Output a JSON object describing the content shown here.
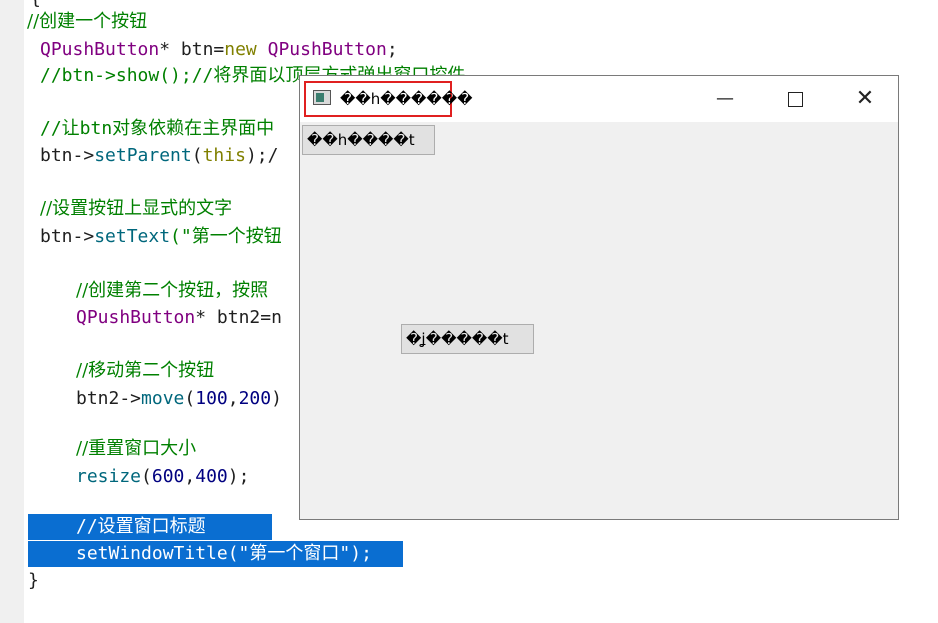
{
  "editor": {
    "top_brace": "{",
    "close_brace": "}",
    "lines": {
      "l1": "//创建一个按钮",
      "l2_type": "QPushButton",
      "l2_mid": "* btn=",
      "l2_new": "new",
      "l2_sp": " ",
      "l2_type2": "QPushButton",
      "l2_end": ";",
      "l3": "//btn->show();//将界面以顶层方式弹出窗口控件",
      "l5": "//让btn对象依赖在主界面中",
      "l6_a": "btn->",
      "l6_fn": "setParent",
      "l6_b": "(",
      "l6_kw": "this",
      "l6_c": ");/",
      "l8": "//设置按钮上显式的文字",
      "l9_a": "btn->",
      "l9_fn": "setText",
      "l9_b": "(\"第一个按钮",
      "l11": "//创建第二个按钮，按照",
      "l12_type": "QPushButton",
      "l12_mid": "* btn2=n",
      "l14": "//移动第二个按钮",
      "l15_a": "btn2->",
      "l15_fn": "move",
      "l15_b": "(",
      "l15_n1": "100",
      "l15_c": ",",
      "l15_n2": "200",
      "l15_d": ")",
      "l17": "//重置窗口大小",
      "l18_fn": "resize",
      "l18_b": "(",
      "l18_n1": "600",
      "l18_c": ",",
      "l18_n2": "400",
      "l18_d": ");",
      "l20": "//设置窗口标题",
      "l21_fn": "setWindowTitle",
      "l21_str": "(\"第一个窗口\");"
    }
  },
  "window": {
    "title": "��h������",
    "minimize_glyph": "—",
    "close_glyph": "✕",
    "button1_label": "��h����t",
    "button2_label": "�ʝ�����t"
  }
}
